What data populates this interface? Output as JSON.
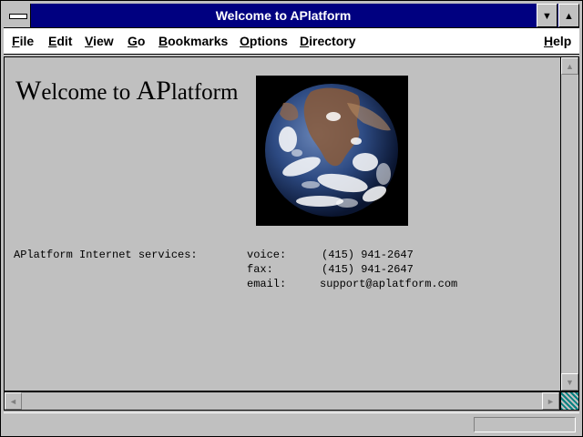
{
  "window": {
    "title": "Welcome to APlatform"
  },
  "menu": {
    "items": [
      {
        "key": "F",
        "rest": "ile"
      },
      {
        "key": "E",
        "rest": "dit"
      },
      {
        "key": "V",
        "rest": "iew"
      },
      {
        "key": "G",
        "rest": "o"
      },
      {
        "key": "B",
        "rest": "ookmarks"
      },
      {
        "key": "O",
        "rest": "ptions"
      },
      {
        "key": "D",
        "rest": "irectory"
      }
    ],
    "help": {
      "key": "H",
      "rest": "elp"
    }
  },
  "page": {
    "heading_cap": "W",
    "heading_rest": "elcome to ",
    "heading_cap2": "AP",
    "heading_rest2": "latform",
    "services_label": "APlatform Internet services:",
    "contacts": [
      {
        "label": "voice:",
        "value": "(415) 941-2647"
      },
      {
        "label": "fax:",
        "value": "(415) 941-2647"
      },
      {
        "label": "email:",
        "value": "support@aplatform.com"
      }
    ]
  },
  "icons": {
    "minimize": "▼",
    "maximize": "▲",
    "scroll_up": "▲",
    "scroll_down": "▼",
    "scroll_left": "◄",
    "scroll_right": "►"
  },
  "colors": {
    "titlebar": "#000080",
    "chrome": "#c0c0c0",
    "menubar": "#ffffff"
  }
}
